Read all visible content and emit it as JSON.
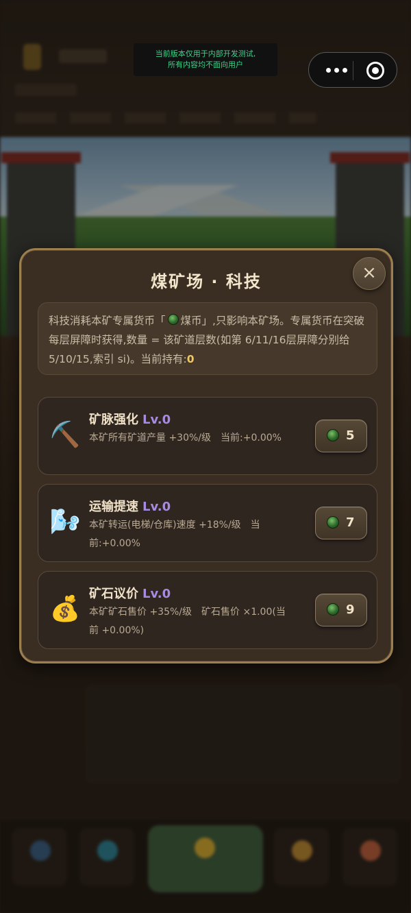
{
  "notice": {
    "line1": "当前版本仅用于内部开发测试,",
    "line2": "所有内容均不面向用户"
  },
  "capsule": {
    "more_icon": "more-dots-icon",
    "close_icon": "target-circle-icon"
  },
  "modal": {
    "title": "煤矿场 · 科技",
    "close_label": "×",
    "description": {
      "pre": "科技消耗本矿专属货币「",
      "currency": "煤币」,只影响本矿场。专属货币在突破每层屏障时获得,数量 = 该矿道层数(如第 6/11/16层屏障分别给 5/10/15,索引 si)。当前持有:",
      "holding": "0"
    },
    "techs": [
      {
        "icon": "pickaxe-icon",
        "icon_glyph": "⛏️",
        "name": "矿脉强化",
        "level": "Lv.0",
        "info": "本矿所有矿道产量 +30%/级　当前:+0.00%",
        "cost": "5"
      },
      {
        "icon": "wind-icon",
        "icon_glyph": "🌬️",
        "name": "运输提速",
        "level": "Lv.0",
        "info": "本矿转运(电梯/仓库)速度 +18%/级　当前:+0.00%",
        "cost": "7"
      },
      {
        "icon": "money-bag-icon",
        "icon_glyph": "💰",
        "name": "矿石议价",
        "level": "Lv.0",
        "info": "本矿矿石售价 +35%/级　矿石售价 ×1.00(当前 +0.00%)",
        "cost": "9"
      }
    ]
  }
}
